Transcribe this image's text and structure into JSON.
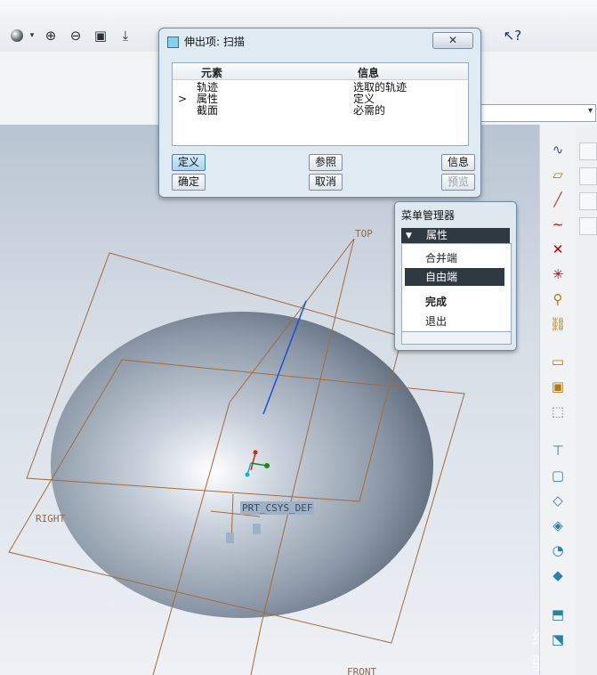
{
  "dialog": {
    "title": "伸出项: 扫描",
    "col_element": "元素",
    "col_info": "信息",
    "rows": [
      {
        "element": "轨迹",
        "info": "选取的轨迹"
      },
      {
        "element": "属性",
        "info": "定义"
      },
      {
        "element": "截面",
        "info": "必需的"
      }
    ],
    "current_row_marker": ">",
    "buttons": {
      "define": "定义",
      "refs": "参照",
      "info": "信息",
      "ok": "确定",
      "cancel": "取消",
      "preview": "预览"
    }
  },
  "menu_manager": {
    "title": "菜单管理器",
    "group": "属性",
    "items": [
      "合并端",
      "自由端",
      "完成",
      "退出"
    ],
    "selected_item": "自由端"
  },
  "model_labels": {
    "top": "TOP",
    "right": "RIGHT",
    "front": "FRONT",
    "csys": "PRT_CSYS_DEF"
  },
  "colors": {
    "datum": "#a86a38",
    "trajectory": "#1d4fd8",
    "menu_highlight": "#2f3942"
  },
  "icons": [
    "sphere-icon",
    "zoom-in-icon",
    "zoom-out-icon",
    "refit-icon",
    "whats-this-icon",
    "sketch-icon",
    "datum-plane-icon",
    "datum-axis-icon",
    "curve-icon",
    "datum-point-icon",
    "csys-icon",
    "analysis-icon"
  ],
  "watermark": "经验"
}
